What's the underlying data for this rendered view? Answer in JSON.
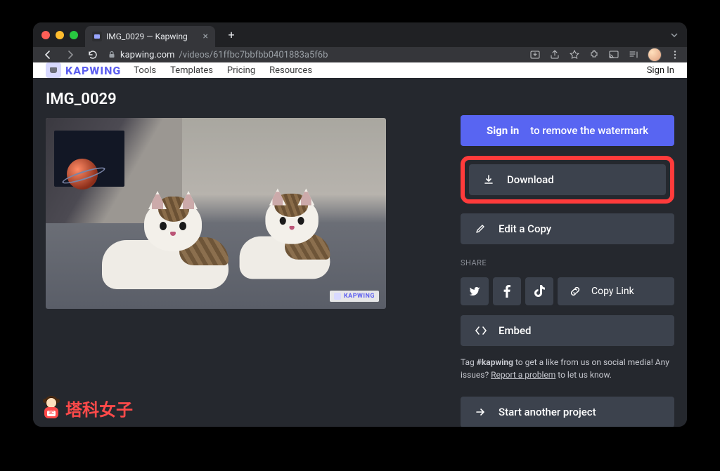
{
  "browser": {
    "tab_title": "IMG_0029 — Kapwing",
    "url_domain": "kapwing.com",
    "url_path": "/videos/61ffbc7bbfbb0401883a5f6b"
  },
  "header": {
    "brand": "KAPWING",
    "nav": [
      "Tools",
      "Templates",
      "Pricing",
      "Resources"
    ],
    "signin": "Sign In"
  },
  "page": {
    "file_title": "IMG_0029",
    "watermark_brand": "KAPWING"
  },
  "actions": {
    "signin_cta_bold": "Sign in",
    "signin_cta_rest": " to remove the watermark",
    "download": "Download",
    "edit_copy": "Edit a Copy",
    "share_label": "SHARE",
    "copy_link": "Copy Link",
    "embed": "Embed",
    "start_another": "Start another project"
  },
  "share_targets": [
    "twitter",
    "facebook",
    "tiktok"
  ],
  "footer_note": {
    "prefix": "Tag ",
    "hashtag": "#kapwing",
    "mid": " to get a like from us on social media! Any issues? ",
    "report": "Report a problem",
    "suffix": " to let us know."
  },
  "overlay": {
    "taike_text": "塔科女子",
    "taike_tag": "3C"
  }
}
